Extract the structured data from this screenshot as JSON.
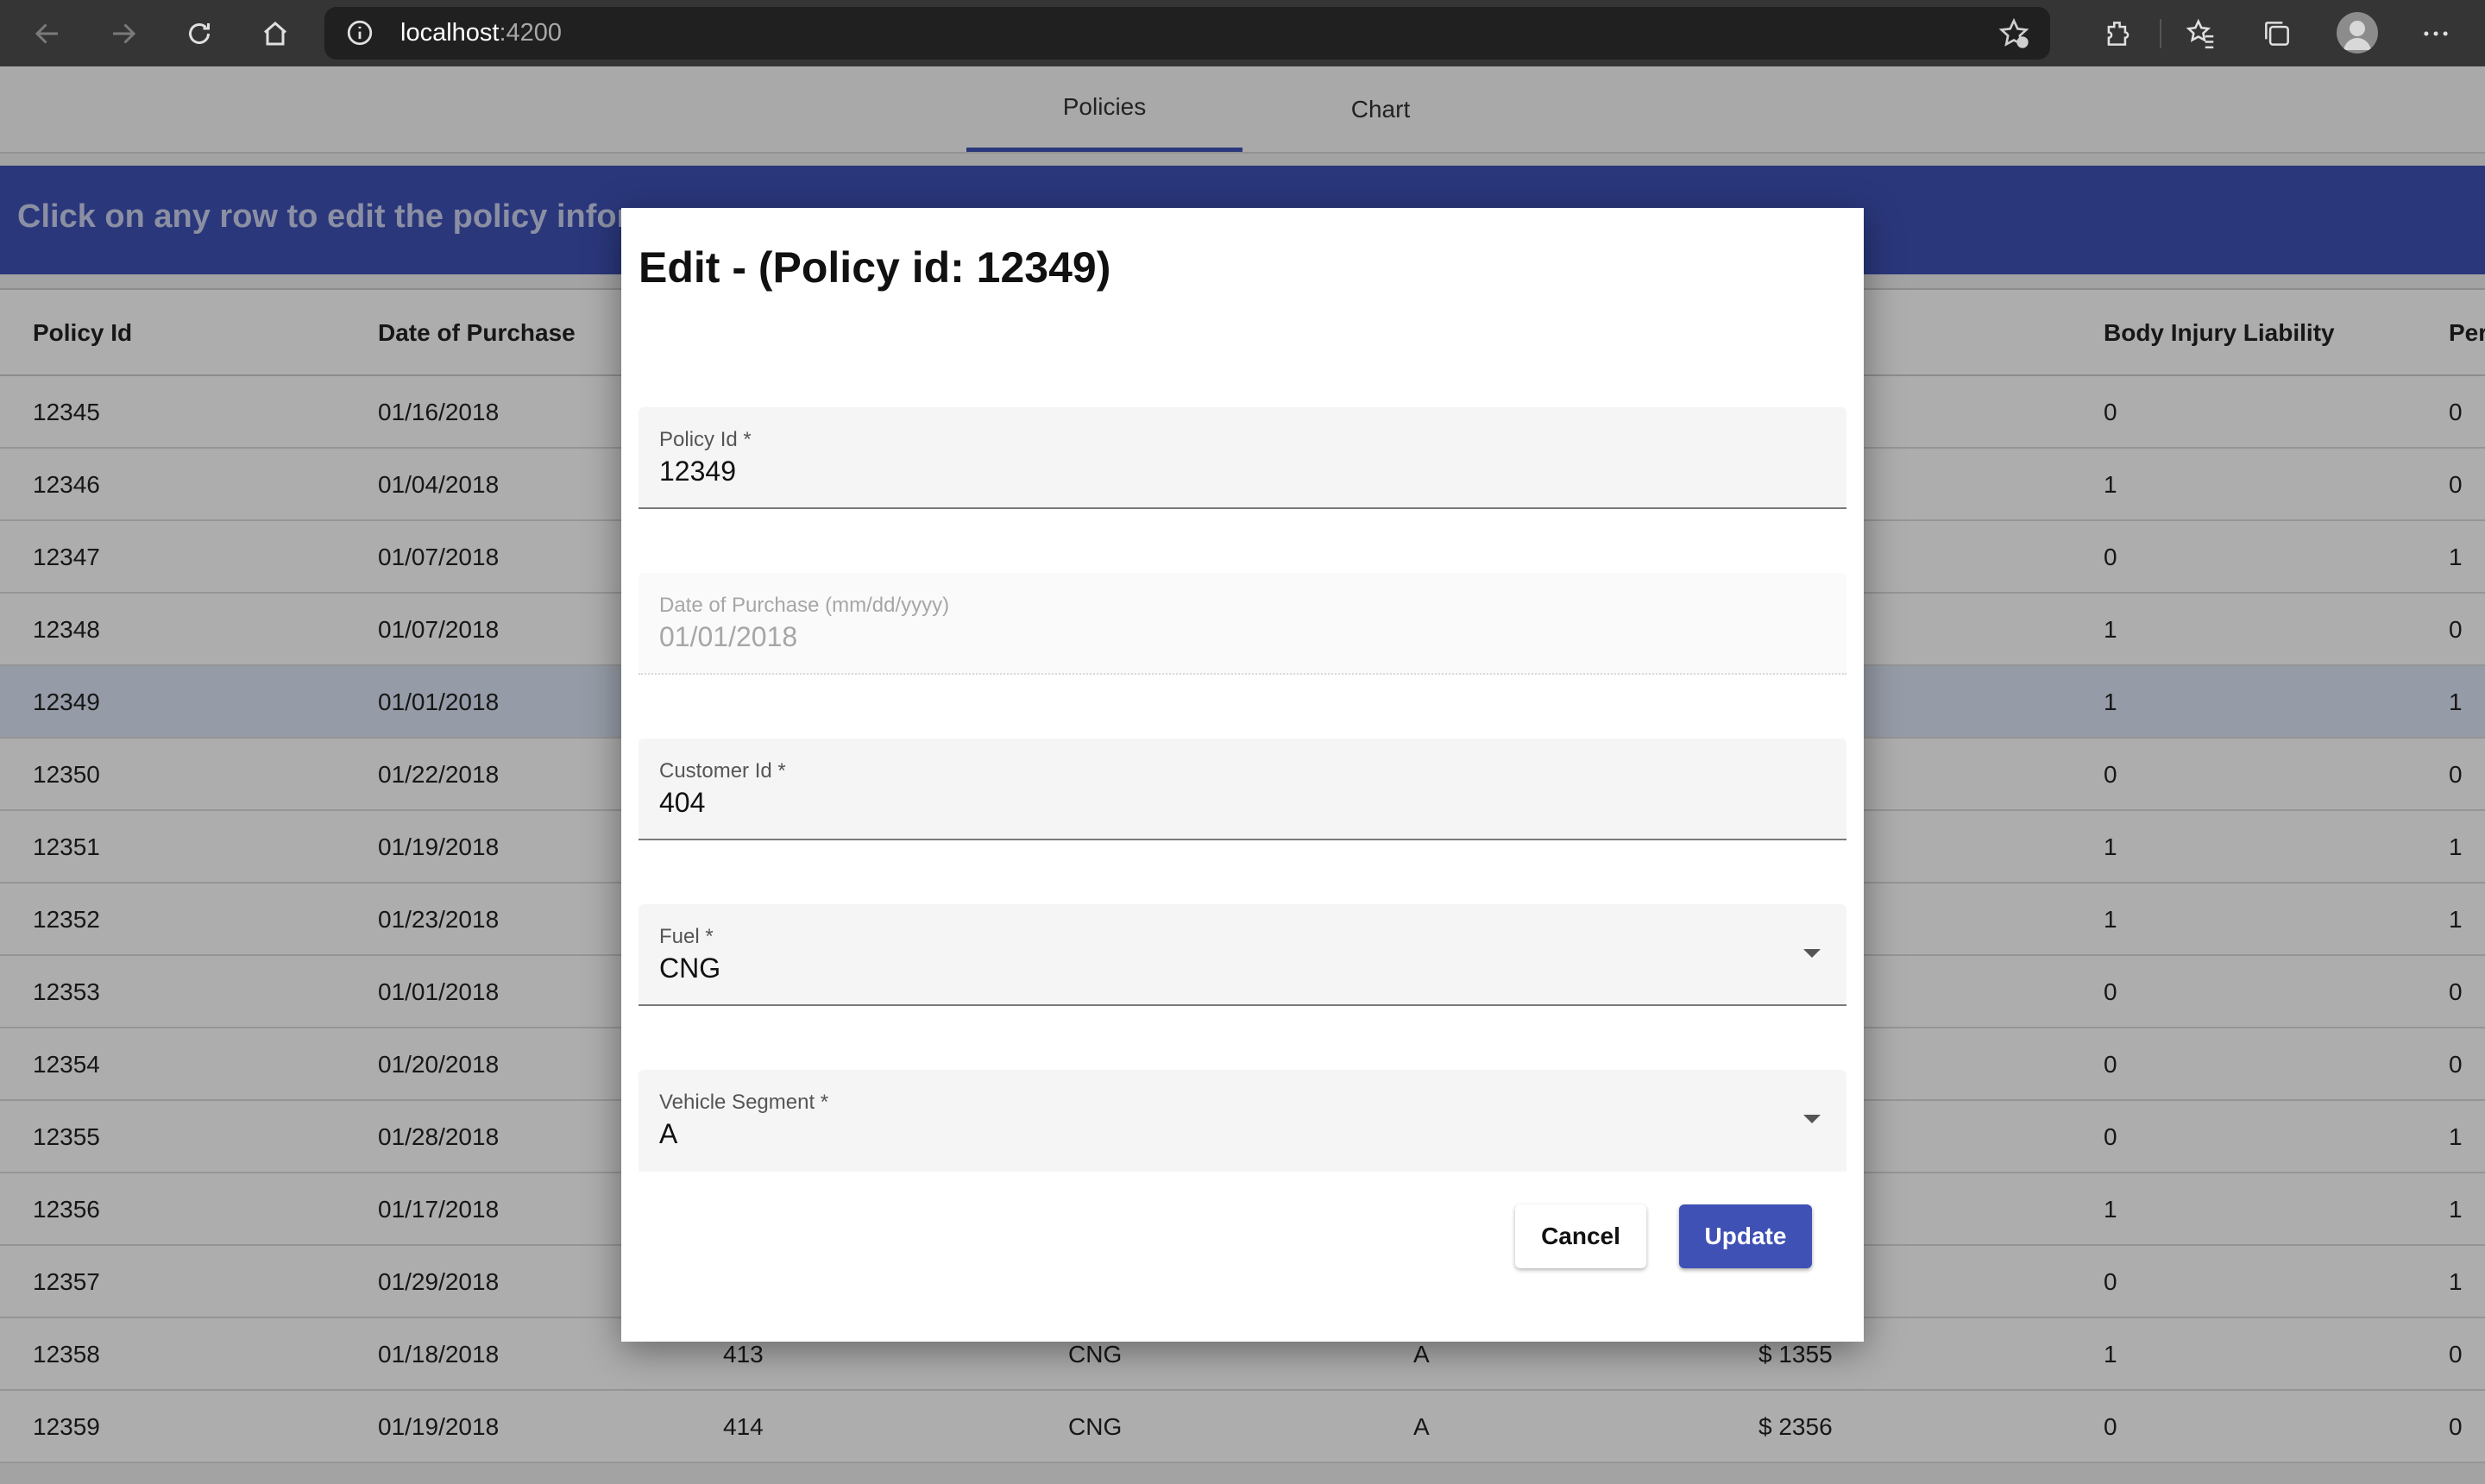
{
  "browser": {
    "url_host": "localhost",
    "url_port": ":4200"
  },
  "tabs": [
    {
      "label": "Policies",
      "active": true
    },
    {
      "label": "Chart",
      "active": false
    }
  ],
  "banner": {
    "text": "Click on any row to edit the policy informa"
  },
  "table": {
    "columns": [
      "Policy Id",
      "Date of Purchase",
      "",
      "",
      "",
      "",
      "Body Injury Liability",
      "Per"
    ],
    "rows": [
      {
        "policy_id": "12345",
        "date": "01/16/2018",
        "customer": "",
        "fuel": "",
        "segment": "",
        "premium": "",
        "bil": "0",
        "per": "0"
      },
      {
        "policy_id": "12346",
        "date": "01/04/2018",
        "customer": "",
        "fuel": "",
        "segment": "",
        "premium": "",
        "bil": "1",
        "per": "0"
      },
      {
        "policy_id": "12347",
        "date": "01/07/2018",
        "customer": "",
        "fuel": "",
        "segment": "",
        "premium": "",
        "bil": "0",
        "per": "1"
      },
      {
        "policy_id": "12348",
        "date": "01/07/2018",
        "customer": "",
        "fuel": "",
        "segment": "",
        "premium": "",
        "bil": "1",
        "per": "0"
      },
      {
        "policy_id": "12349",
        "date": "01/01/2018",
        "customer": "",
        "fuel": "",
        "segment": "",
        "premium": "",
        "bil": "1",
        "per": "1"
      },
      {
        "policy_id": "12350",
        "date": "01/22/2018",
        "customer": "",
        "fuel": "",
        "segment": "",
        "premium": "",
        "bil": "0",
        "per": "0"
      },
      {
        "policy_id": "12351",
        "date": "01/19/2018",
        "customer": "",
        "fuel": "",
        "segment": "",
        "premium": "",
        "bil": "1",
        "per": "1"
      },
      {
        "policy_id": "12352",
        "date": "01/23/2018",
        "customer": "",
        "fuel": "",
        "segment": "",
        "premium": "",
        "bil": "1",
        "per": "1"
      },
      {
        "policy_id": "12353",
        "date": "01/01/2018",
        "customer": "",
        "fuel": "",
        "segment": "",
        "premium": "",
        "bil": "0",
        "per": "0"
      },
      {
        "policy_id": "12354",
        "date": "01/20/2018",
        "customer": "",
        "fuel": "",
        "segment": "",
        "premium": "",
        "bil": "0",
        "per": "0"
      },
      {
        "policy_id": "12355",
        "date": "01/28/2018",
        "customer": "",
        "fuel": "",
        "segment": "",
        "premium": "",
        "bil": "0",
        "per": "1"
      },
      {
        "policy_id": "12356",
        "date": "01/17/2018",
        "customer": "",
        "fuel": "",
        "segment": "",
        "premium": "",
        "bil": "1",
        "per": "1"
      },
      {
        "policy_id": "12357",
        "date": "01/29/2018",
        "customer": "",
        "fuel": "",
        "segment": "",
        "premium": "",
        "bil": "0",
        "per": "1"
      },
      {
        "policy_id": "12358",
        "date": "01/18/2018",
        "customer": "413",
        "fuel": "CNG",
        "segment": "A",
        "premium": "$ 1355",
        "bil": "1",
        "per": "0"
      },
      {
        "policy_id": "12359",
        "date": "01/19/2018",
        "customer": "414",
        "fuel": "CNG",
        "segment": "A",
        "premium": "$ 2356",
        "bil": "0",
        "per": "0"
      }
    ]
  },
  "dialog": {
    "title": "Edit - (Policy id: 12349)",
    "fields": [
      {
        "label": "Policy Id *",
        "value": "12349"
      },
      {
        "label": "Date of Purchase (mm/dd/yyyy)",
        "value": "01/01/2018"
      },
      {
        "label": "Customer Id *",
        "value": "404"
      },
      {
        "label": "Fuel *",
        "value": "CNG"
      },
      {
        "label": "Vehicle Segment *",
        "value": "A"
      }
    ],
    "cancel_label": "Cancel",
    "update_label": "Update"
  },
  "colors": {
    "accent": "#3f51b5",
    "selected_row": "#dde6f6",
    "chrome": "#353535"
  }
}
